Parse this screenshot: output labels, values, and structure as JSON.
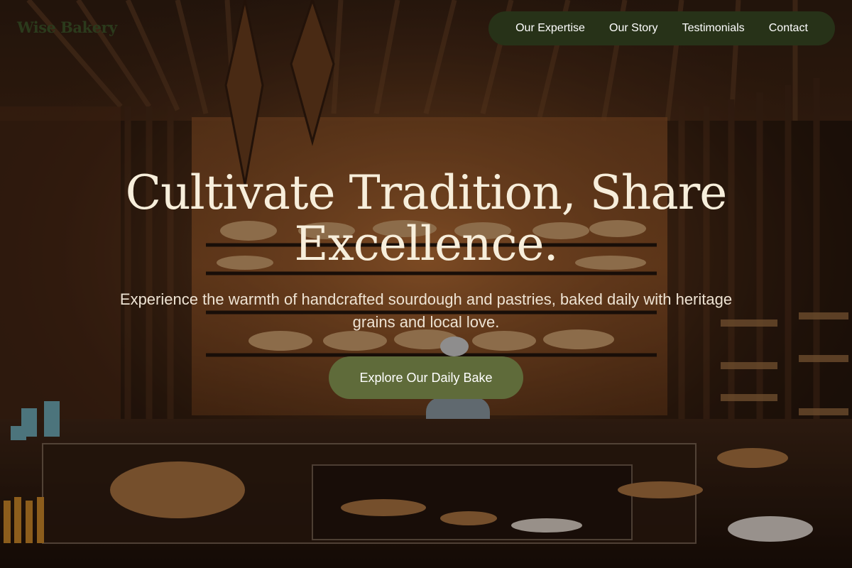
{
  "header": {
    "brand": "Wise Bakery",
    "nav": [
      {
        "label": "Our Expertise"
      },
      {
        "label": "Our Story"
      },
      {
        "label": "Testimonials"
      },
      {
        "label": "Contact"
      }
    ]
  },
  "hero": {
    "title": "Cultivate Tradition, Share Excellence.",
    "subtitle": "Experience the warmth of handcrafted sourdough and pastries, baked daily with heritage grains and local love.",
    "cta_label": "Explore Our Daily Bake",
    "background_image": "bakery interior with bread shelves and display counter"
  },
  "colors": {
    "nav_background": "#273218",
    "brand_text": "#2b3a1c",
    "cta_background": "#5f6b3a",
    "title_text": "#f7eedb"
  }
}
